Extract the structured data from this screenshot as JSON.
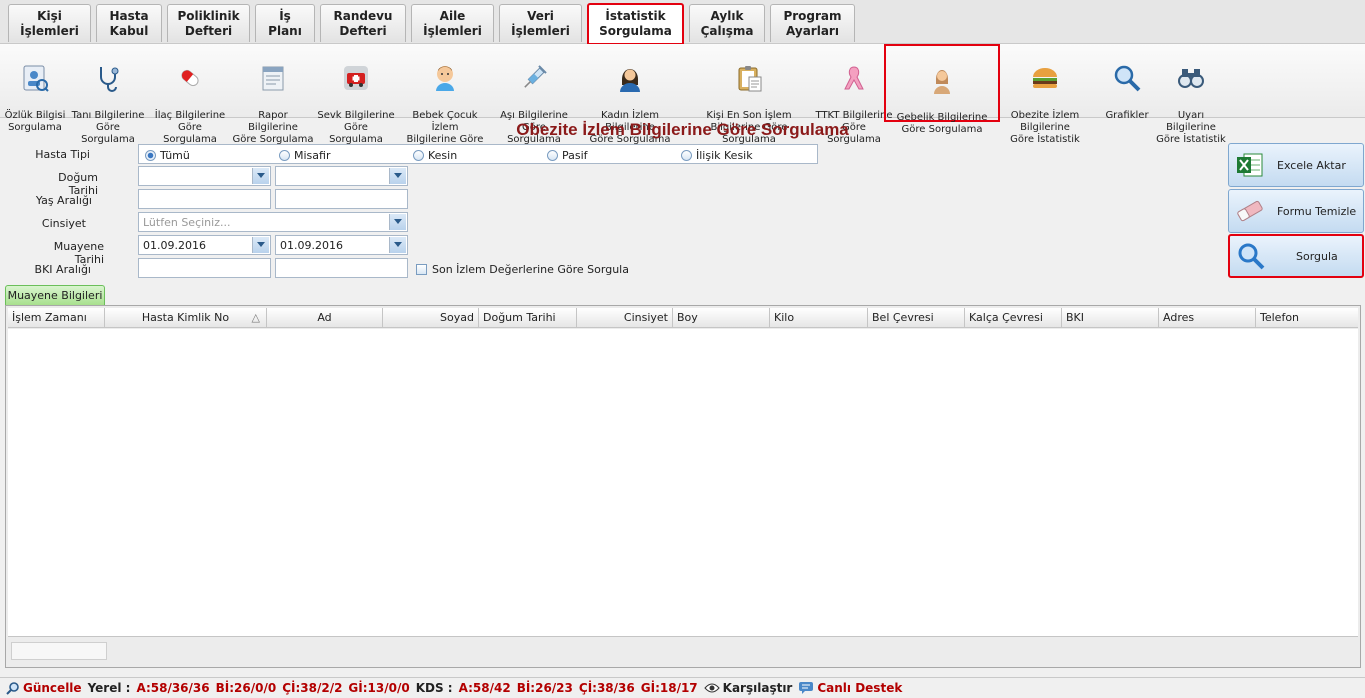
{
  "tabs": [
    {
      "label": "Kişi\nİşlemleri"
    },
    {
      "label": "Hasta\nKabul"
    },
    {
      "label": "Poliklinik\nDefteri"
    },
    {
      "label": "İş\nPlanı"
    },
    {
      "label": "Randevu\nDefteri"
    },
    {
      "label": "Aile\nİşlemleri"
    },
    {
      "label": "Veri\nİşlemleri"
    },
    {
      "label": "İstatistik\nSorgulama"
    },
    {
      "label": "Aylık\nÇalışma"
    },
    {
      "label": "Program\nAyarları"
    }
  ],
  "toolbar": {
    "items": [
      {
        "label": "Özlük Bilgisi\nSorgulama",
        "icon": "id-card-icon"
      },
      {
        "label": "Tanı Bilgilerine\nGöre Sorgulama",
        "icon": "stethoscope-icon"
      },
      {
        "label": "İlaç Bilgilerine\nGöre Sorgulama",
        "icon": "pill-icon"
      },
      {
        "label": "Rapor Bilgilerine\nGöre Sorgulama",
        "icon": "report-icon"
      },
      {
        "label": "Sevk Bilgilerine\nGöre Sorgulama",
        "icon": "ambulance-icon"
      },
      {
        "label": "Bebek Çocuk İzlem\nBilgilerine Göre",
        "icon": "baby-icon"
      },
      {
        "label": "Aşı Bilgilerine\nGöre Sorgulama",
        "icon": "syringe-icon"
      },
      {
        "label": "Kadın İzlem Bilgilerine\nGöre Sorgulama",
        "icon": "woman-icon"
      },
      {
        "label": "Kişi En Son İşlem\nBilgilerine Göre Sorgulama",
        "icon": "clipboard-icon"
      },
      {
        "label": "TTKT Bilgilerine\nGöre Sorgulama",
        "icon": "ribbon-icon"
      },
      {
        "label": "Gebelik Bilgilerine\nGöre Sorgulama",
        "icon": "pregnant-woman-icon"
      },
      {
        "label": "Obezite İzlem Bilgilerine\nGöre İstatistik",
        "icon": "burger-icon"
      },
      {
        "label": "Grafikler",
        "icon": "magnifier-icon"
      },
      {
        "label": "Uyarı Bilgilerine\nGöre İstatistik",
        "icon": "binoculars-icon"
      }
    ]
  },
  "page_title": "Obezite İzlem Bilgilerine Göre Sorgulama",
  "form": {
    "hasta_tipi_label": "Hasta Tipi",
    "hasta_tipi_options": [
      "Tümü",
      "Misafir",
      "Kesin",
      "Pasif",
      "İlişik Kesik"
    ],
    "hasta_tipi_selected": "Tümü",
    "dogum_tarihi_label": "Doğum Tarihi",
    "dogum_tarihi_from": "",
    "dogum_tarihi_to": "",
    "yas_araligi_label": "Yaş Aralığı",
    "yas_from": "",
    "yas_to": "",
    "cinsiyet_label": "Cinsiyet",
    "cinsiyet_placeholder": "Lütfen Seçiniz...",
    "muayene_tarihi_label": "Muayene Tarihi",
    "muayene_from": "01.09.2016",
    "muayene_to": "01.09.2016",
    "bki_label": "BKI Aralığı",
    "bki_from": "",
    "bki_to": "",
    "son_izlem_label": "Son İzlem Değerlerine Göre Sorgula",
    "son_izlem_checked": false
  },
  "actions": {
    "export_label": "Excele Aktar",
    "clear_label": "Formu Temizle",
    "query_label": "Sorgula"
  },
  "grid": {
    "tab_label": "Muayene Bilgileri",
    "columns": [
      "İşlem Zamanı",
      "Hasta Kimlik No",
      "Ad",
      "Soyad",
      "Doğum Tarihi",
      "Cinsiyet",
      "Boy",
      "Kilo",
      "Bel Çevresi",
      "Kalça Çevresi",
      "BKI",
      "Adres",
      "Telefon"
    ],
    "sort_indicator": "△",
    "rows": []
  },
  "status": {
    "guncelle": "Güncelle",
    "yerel_label": "Yerel :",
    "yerel_a": "A:58/36/36",
    "yerel_bi": "Bİ:26/0/0",
    "yerel_ci": "Çİ:38/2/2",
    "yerel_gi": "Gİ:13/0/0",
    "kds_label": "KDS :",
    "kds_a": "A:58/42",
    "kds_bi": "Bİ:26/23",
    "kds_ci": "Çİ:38/36",
    "kds_gi": "Gİ:18/17",
    "karsilastir": "Karşılaştır",
    "canli_destek": "Canlı Destek"
  }
}
